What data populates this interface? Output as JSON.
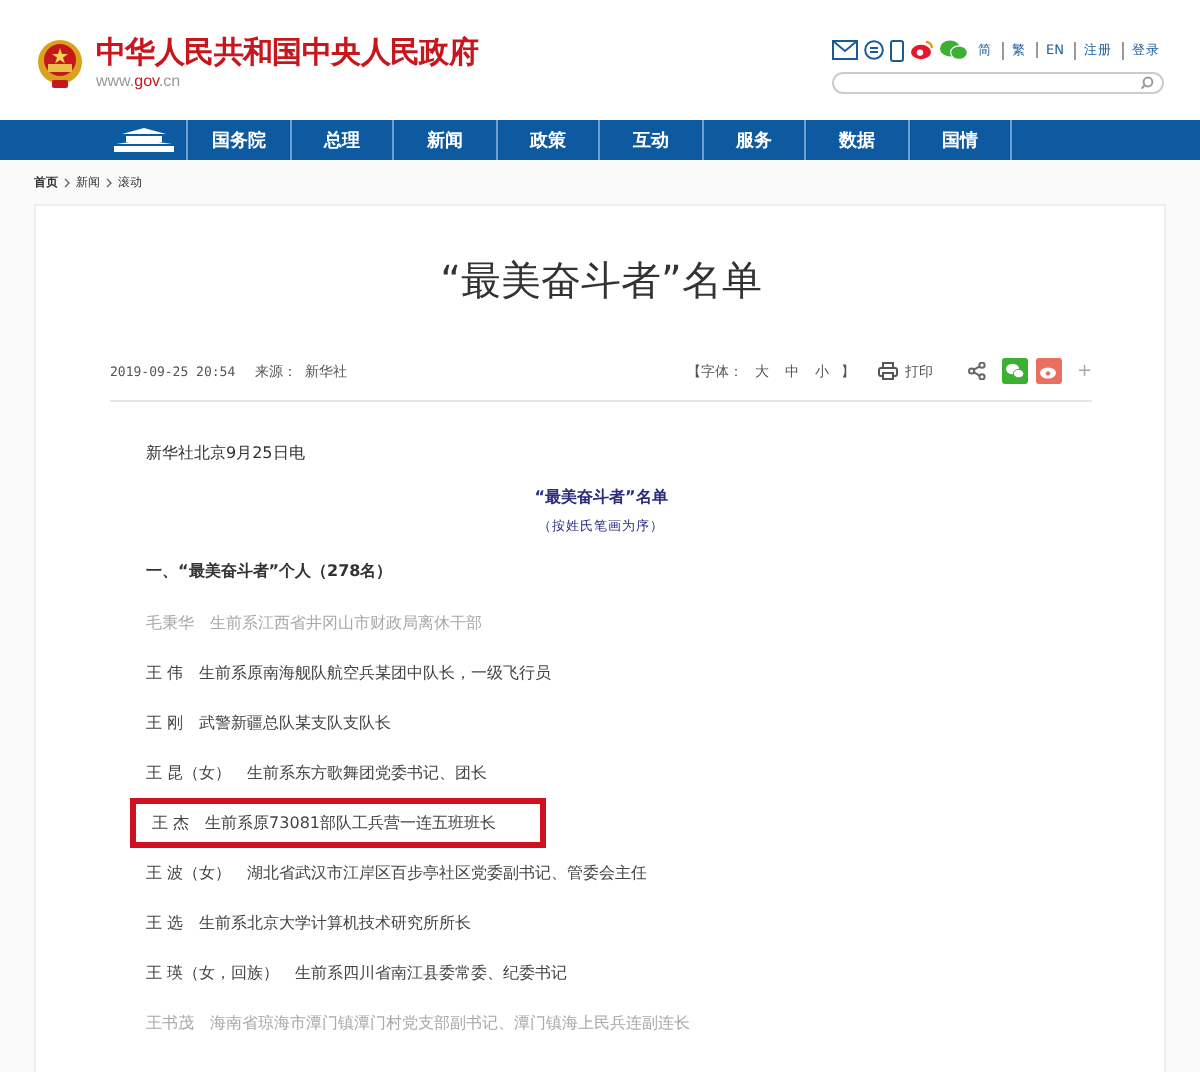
{
  "site": {
    "title": "中华人民共和国中央人民政府",
    "domain_prefix": "www.",
    "domain_main": "gov",
    "domain_suffix": ".cn"
  },
  "top_links": [
    "简",
    "繁",
    "EN",
    "注册",
    "登录"
  ],
  "nav": [
    "国务院",
    "总理",
    "新闻",
    "政策",
    "互动",
    "服务",
    "数据",
    "国情"
  ],
  "breadcrumb": [
    "首页",
    "新闻",
    "滚动"
  ],
  "article": {
    "title": "“最美奋斗者”名单",
    "date": "2019-09-25 20:54",
    "source_label": "来源：",
    "source": "新华社",
    "font_label": "【字体：",
    "font_sizes": [
      "大",
      "中",
      "小"
    ],
    "font_end": "】",
    "print": "打印",
    "more": "+",
    "dateline": "新华社北京9月25日电",
    "subtitle": "“最美奋斗者”名单",
    "note": "（按姓氏笔画为序）",
    "section": "一、“最美奋斗者”个人（278名）",
    "rows": [
      {
        "name": "毛秉华",
        "desc": "生前系江西省井冈山市财政局离休干部",
        "faded": true,
        "highlighted": false
      },
      {
        "name": "王 伟",
        "desc": "生前系原南海舰队航空兵某团中队长，一级飞行员",
        "faded": false,
        "highlighted": false
      },
      {
        "name": "王 刚",
        "desc": "武警新疆总队某支队支队长",
        "faded": false,
        "highlighted": false
      },
      {
        "name": "王 昆（女）",
        "desc": "生前系东方歌舞团党委书记、团长",
        "faded": false,
        "highlighted": false
      },
      {
        "name": "王 杰",
        "desc": "生前系原73081部队工兵营一连五班班长",
        "faded": false,
        "highlighted": true
      },
      {
        "name": "王 波（女）",
        "desc": "湖北省武汉市江岸区百步亭社区党委副书记、管委会主任",
        "faded": false,
        "highlighted": false
      },
      {
        "name": "王 选",
        "desc": "生前系北京大学计算机技术研究所所长",
        "faded": false,
        "highlighted": false
      },
      {
        "name": "王 瑛（女，回族）",
        "desc": "生前系四川省南江县委常委、纪委书记",
        "faded": false,
        "highlighted": false
      },
      {
        "name": "王书茂",
        "desc": "海南省琼海市潭门镇潭门村党支部副书记、潭门镇海上民兵连副连长",
        "faded": true,
        "highlighted": false
      }
    ]
  }
}
